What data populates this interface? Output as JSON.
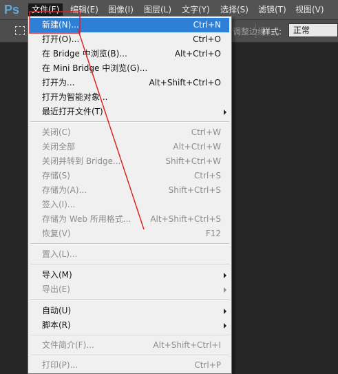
{
  "app": {
    "logo": "Ps"
  },
  "menubar": {
    "items": [
      {
        "label": "文件(F)",
        "active": true
      },
      {
        "label": "编辑(E)"
      },
      {
        "label": "图像(I)"
      },
      {
        "label": "图层(L)"
      },
      {
        "label": "文字(Y)"
      },
      {
        "label": "选择(S)"
      },
      {
        "label": "滤镜(T)"
      },
      {
        "label": "视图(V)"
      }
    ]
  },
  "optionsbar": {
    "partial_label": "调整边缘",
    "style_label": "样式:",
    "style_value": "正常"
  },
  "file_menu": {
    "items": [
      {
        "label": "新建(N)...",
        "shortcut": "Ctrl+N",
        "highlighted": true
      },
      {
        "label": "打开(O)...",
        "shortcut": "Ctrl+O"
      },
      {
        "label": "在 Bridge 中浏览(B)...",
        "shortcut": "Alt+Ctrl+O"
      },
      {
        "label": "在 Mini Bridge 中浏览(G)...",
        "shortcut": ""
      },
      {
        "label": "打开为...",
        "shortcut": "Alt+Shift+Ctrl+O"
      },
      {
        "label": "打开为智能对象...",
        "shortcut": ""
      },
      {
        "label": "最近打开文件(T)",
        "shortcut": "",
        "submenu": true
      },
      {
        "label": "关闭(C)",
        "shortcut": "Ctrl+W",
        "disabled": true
      },
      {
        "label": "关闭全部",
        "shortcut": "Alt+Ctrl+W",
        "disabled": true
      },
      {
        "label": "关闭并转到 Bridge...",
        "shortcut": "Shift+Ctrl+W",
        "disabled": true
      },
      {
        "label": "存储(S)",
        "shortcut": "Ctrl+S",
        "disabled": true
      },
      {
        "label": "存储为(A)...",
        "shortcut": "Shift+Ctrl+S",
        "disabled": true
      },
      {
        "label": "签入(I)...",
        "shortcut": "",
        "disabled": true
      },
      {
        "label": "存储为 Web 所用格式...",
        "shortcut": "Alt+Shift+Ctrl+S",
        "disabled": true
      },
      {
        "label": "恢复(V)",
        "shortcut": "F12",
        "disabled": true
      },
      {
        "label": "置入(L)...",
        "shortcut": "",
        "disabled": true
      },
      {
        "label": "导入(M)",
        "shortcut": "",
        "submenu": true
      },
      {
        "label": "导出(E)",
        "shortcut": "",
        "submenu": true,
        "disabled": true
      },
      {
        "label": "自动(U)",
        "shortcut": "",
        "submenu": true
      },
      {
        "label": "脚本(R)",
        "shortcut": "",
        "submenu": true
      },
      {
        "label": "文件简介(F)...",
        "shortcut": "Alt+Shift+Ctrl+I",
        "disabled": true
      },
      {
        "label": "打印(P)...",
        "shortcut": "Ctrl+P",
        "disabled": true
      }
    ]
  },
  "colors": {
    "highlight": "#2e7fd6",
    "annotation": "#d9232a"
  }
}
